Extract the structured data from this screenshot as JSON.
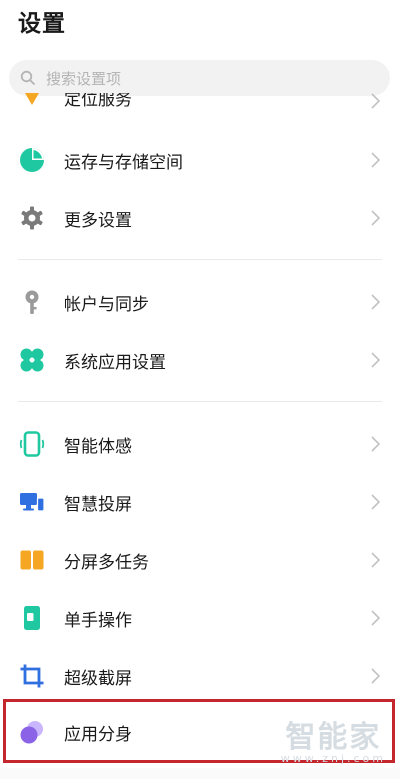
{
  "page_title": "设置",
  "search": {
    "placeholder": "搜索设置项"
  },
  "partial_item": {
    "label": "定位服务"
  },
  "items": [
    {
      "label": "运存与存储空间",
      "icon": "pie-chart-icon"
    },
    {
      "label": "更多设置",
      "icon": "gear-icon"
    },
    {
      "label": "帐户与同步",
      "icon": "key-icon"
    },
    {
      "label": "系统应用设置",
      "icon": "clover-icon"
    },
    {
      "label": "智能体感",
      "icon": "phone-outline-icon"
    },
    {
      "label": "智慧投屏",
      "icon": "screen-cast-icon"
    },
    {
      "label": "分屏多任务",
      "icon": "split-screen-icon"
    },
    {
      "label": "单手操作",
      "icon": "one-hand-icon"
    },
    {
      "label": "超级截屏",
      "icon": "crop-icon"
    },
    {
      "label": "应用分身",
      "icon": "app-clone-icon"
    }
  ],
  "colors": {
    "accent_green": "#1fc8a0",
    "gear_gray": "#7a7a7a",
    "key_gray": "#9a9a9a",
    "blue": "#2f6fe0",
    "orange": "#f5a623",
    "purple": "#8a63e6",
    "highlight_red": "#c4262e"
  },
  "watermark": {
    "main": "智能家",
    "sub": "www.znj.com"
  }
}
